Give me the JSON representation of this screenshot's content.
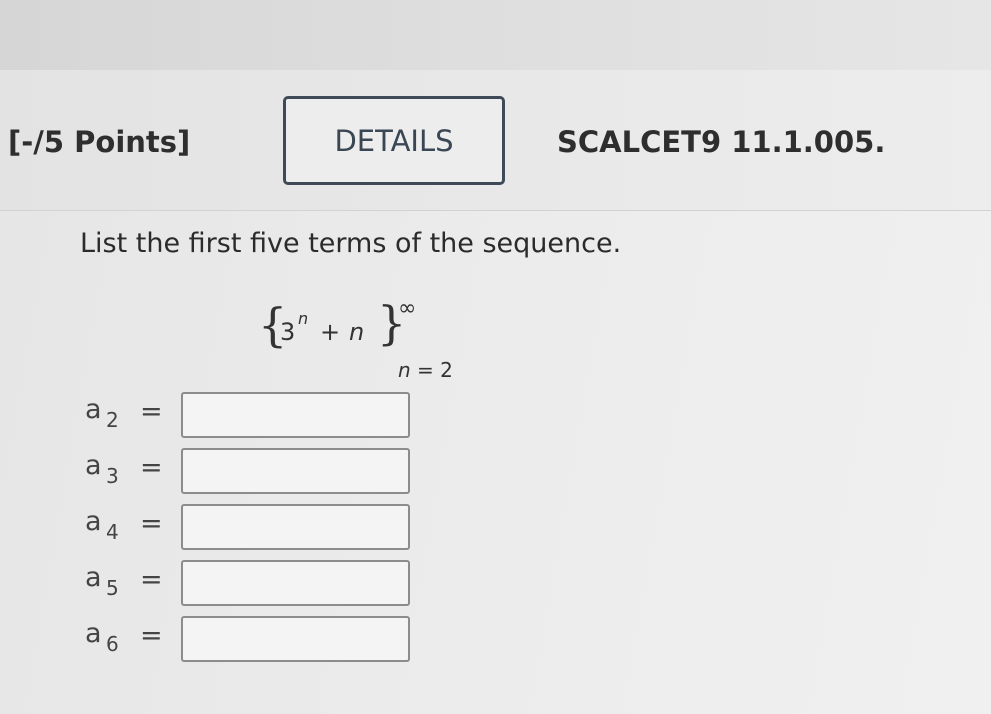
{
  "header": {
    "points_label": "[-/5 Points]",
    "details_label": "DETAILS",
    "problem_id": "SCALCET9 11.1.005."
  },
  "question": {
    "instructions": "List the first five terms of the sequence.",
    "formula": {
      "base": "3",
      "exponent": "n",
      "operator": "+",
      "variable": "n",
      "upper_limit": "∞",
      "lower_limit_var": "n",
      "lower_limit_rest": " = 2"
    }
  },
  "answers": [
    {
      "label": "a",
      "subscript": "2",
      "equals": "=",
      "value": ""
    },
    {
      "label": "a",
      "subscript": "3",
      "equals": "=",
      "value": ""
    },
    {
      "label": "a",
      "subscript": "4",
      "equals": "=",
      "value": ""
    },
    {
      "label": "a",
      "subscript": "5",
      "equals": "=",
      "value": ""
    },
    {
      "label": "a",
      "subscript": "6",
      "equals": "=",
      "value": ""
    }
  ]
}
